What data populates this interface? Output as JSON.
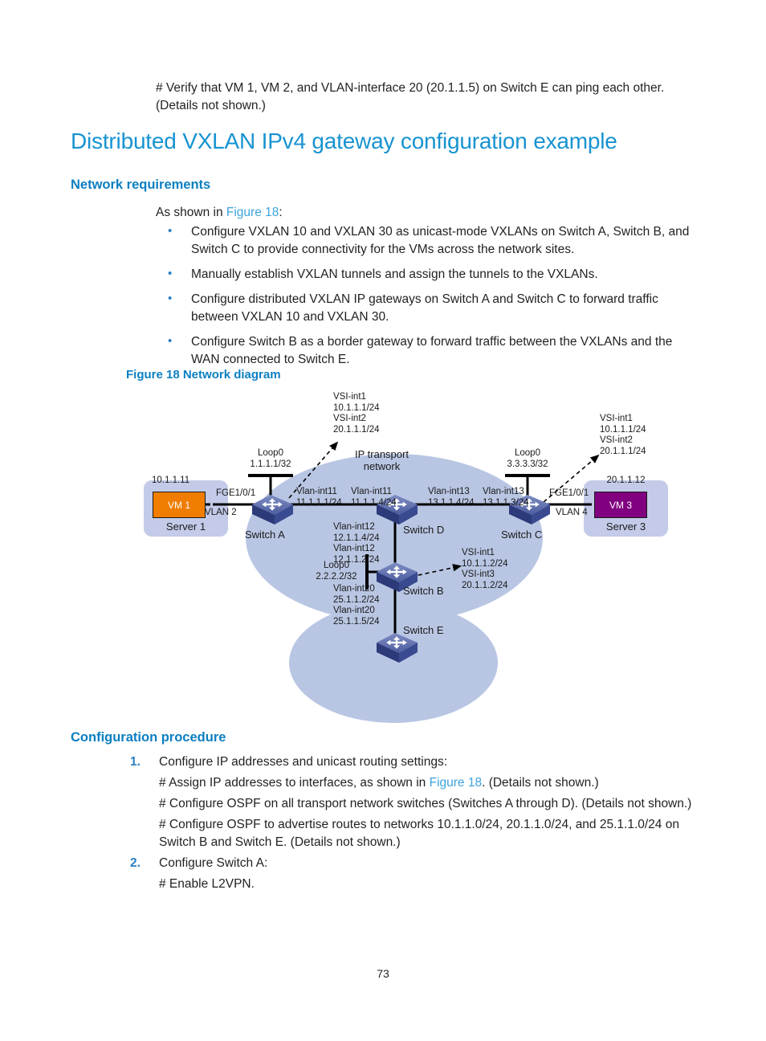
{
  "page": {
    "number": "73",
    "intro_note": "# Verify that VM 1, VM 2, and VLAN-interface 20 (20.1.1.5) on Switch E can ping each other. (Details not shown.)",
    "title": "Distributed VXLAN IPv4 gateway configuration example"
  },
  "network_requirements": {
    "heading": "Network requirements",
    "as_shown_prefix": "As shown in ",
    "as_shown_link": "Figure 18",
    "as_shown_suffix": ":",
    "bullets": [
      "Configure VXLAN 10 and VXLAN 30 as unicast-mode VXLANs on Switch A, Switch B, and Switch C to provide connectivity for the VMs across the network sites.",
      "Manually establish VXLAN tunnels and assign the tunnels to the VXLANs.",
      "Configure distributed VXLAN IP gateways on Switch A and Switch C to forward traffic between VXLAN 10 and VXLAN 30.",
      "Configure Switch B as a border gateway to forward traffic between the VXLANs and the WAN connected to Switch E."
    ]
  },
  "figure": {
    "caption": "Figure 18 Network diagram",
    "cloud_transport_label_line1": "IP transport",
    "cloud_transport_label_line2": "network",
    "labels": {
      "switch_a_vsi": "VSI-int1\n10.1.1.1/24\nVSI-int2\n20.1.1.1/24",
      "switch_a_vsi_l1": "VSI-int1",
      "switch_a_vsi_l2": "10.1.1.1/24",
      "switch_a_vsi_l3": "VSI-int2",
      "switch_a_vsi_l4": "20.1.1.1/24",
      "switch_c_vsi_l1": "VSI-int1",
      "switch_c_vsi_l2": "10.1.1.1/24",
      "switch_c_vsi_l3": "VSI-int2",
      "switch_c_vsi_l4": "20.1.1.1/24",
      "switch_b_vsi_l1": "VSI-int1",
      "switch_b_vsi_l2": "10.1.1.2/24",
      "switch_b_vsi_l3": "VSI-int3",
      "switch_b_vsi_l4": "20.1.1.2/24",
      "loop0_a_l1": "Loop0",
      "loop0_a_l2": "1.1.1.1/32",
      "loop0_c_l1": "Loop0",
      "loop0_c_l2": "3.3.3.3/32",
      "loop0_b_l1": "Loop0",
      "loop0_b_l2": "2.2.2.2/32",
      "vm1_ip": "10.1.1.11",
      "vm1_name": "VM 1",
      "vm1_vlan": "VLAN 2",
      "server1": "Server 1",
      "fge_a": "FGE1/0/1",
      "vm3_ip": "20.1.1.12",
      "vm3_name": "VM 3",
      "vm3_vlan": "VLAN 4",
      "server3": "Server 3",
      "fge_c": "FGE1/0/1",
      "switch_a": "Switch A",
      "switch_b": "Switch B",
      "switch_c": "Switch C",
      "switch_d": "Switch D",
      "switch_e": "Switch E",
      "a_d_left_l1": "Vlan-int11",
      "a_d_left_l2": "11.1.1.1/24",
      "a_d_right_l1": "Vlan-int11",
      "a_d_right_l2": "11.1.1.4/24",
      "d_c_left_l1": "Vlan-int13",
      "d_c_left_l2": "13.1.1.4/24",
      "d_c_right_l1": "Vlan-int13",
      "d_c_right_l2": "13.1.1.3/24",
      "d_b_upper_l1": "Vlan-int12",
      "d_b_upper_l2": "12.1.1.4/24",
      "d_b_lower_l1": "Vlan-int12",
      "d_b_lower_l2": "12.1.1.2/24",
      "b_e_upper_l1": "Vlan-int20",
      "b_e_upper_l2": "25.1.1.2/24",
      "b_e_lower_l1": "Vlan-int20",
      "b_e_lower_l2": "25.1.1.5/24"
    },
    "colors": {
      "cloud": "#b9c6e3",
      "server_box": "#c3cbe8",
      "vm1": "#f07d00",
      "vm3": "#800080",
      "switch_top": "#6b7bb5",
      "switch_body": "#2c3a7a",
      "link": "#000000"
    }
  },
  "configuration_procedure": {
    "heading": "Configuration procedure",
    "steps": [
      {
        "num": "1.",
        "text": "Configure IP addresses and unicast routing settings:"
      },
      {
        "num": "2.",
        "text": "Configure Switch A:"
      }
    ],
    "sub_1_a_prefix": "# Assign IP addresses to interfaces, as shown in ",
    "sub_1_a_link": "Figure 18",
    "sub_1_a_suffix": ". (Details not shown.)",
    "sub_1_b": "# Configure OSPF on all transport network switches (Switches A through D). (Details not shown.)",
    "sub_1_c": "# Configure OSPF to advertise routes to networks 10.1.1.0/24, 20.1.1.0/24, and 25.1.1.0/24 on Switch B and Switch E. (Details not shown.)",
    "sub_2_a": "# Enable L2VPN."
  }
}
